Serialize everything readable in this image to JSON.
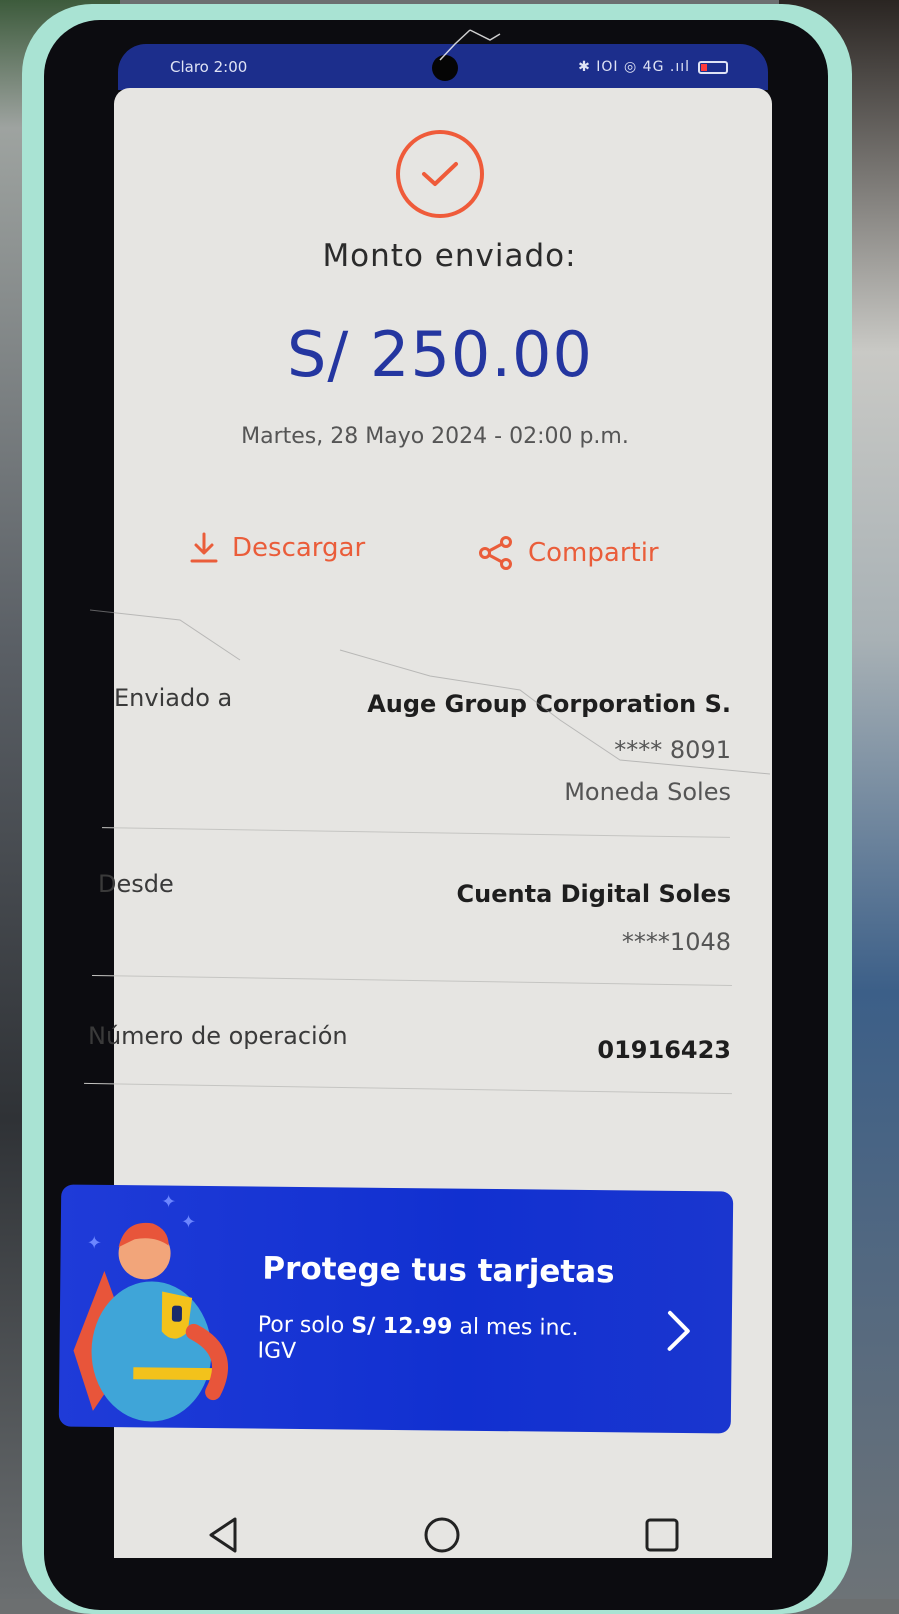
{
  "status_bar": {
    "carrier": "Claro",
    "time": "2:00",
    "indicators": "✱ IOI ◎ 4G .ııl"
  },
  "receipt": {
    "title": "Monto enviado:",
    "amount": "S/ 250.00",
    "datetime": "Martes, 28 Mayo 2024 - 02:00 p.m.",
    "download_label": "Descargar",
    "share_label": "Compartir"
  },
  "details": {
    "sent_to": {
      "label": "Enviado a",
      "name": "Auge Group Corporation S.",
      "account": "**** 8091",
      "currency": "Moneda Soles"
    },
    "from": {
      "label": "Desde",
      "name": "Cuenta Digital Soles",
      "account": "****1048"
    },
    "operation": {
      "label": "Número de operación",
      "value": "01916423"
    }
  },
  "banner": {
    "title": "Protege tus tarjetas",
    "sub_prefix": "Por solo ",
    "price": "S/ 12.99",
    "sub_suffix": " al mes inc. IGV"
  },
  "colors": {
    "accent": "#ef5b3a",
    "amount": "#2436a0",
    "banner": "#1130d0"
  },
  "icons": [
    "check-circle-icon",
    "download-icon",
    "share-icon",
    "chevron-right-icon",
    "back-icon",
    "home-icon",
    "recents-icon"
  ]
}
